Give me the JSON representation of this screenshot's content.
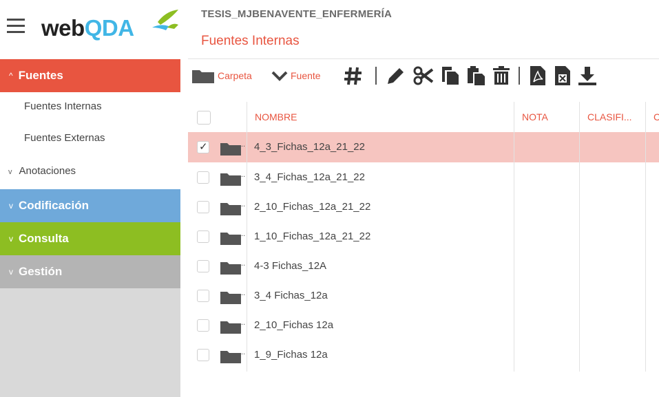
{
  "app": {
    "logo_web": "web",
    "logo_qda": "QDA"
  },
  "sidebar": {
    "fuentes": "Fuentes",
    "fuentes_internas": "Fuentes Internas",
    "fuentes_externas": "Fuentes Externas",
    "anotaciones": "Anotaciones",
    "codificacion": "Codificación",
    "consulta": "Consulta",
    "gestion": "Gestión",
    "colors": {
      "fuentes": "#e85540",
      "codificacion": "#6fa9da",
      "consulta": "#8dbe22",
      "gestion": "#b4b4b4"
    }
  },
  "header": {
    "project": "TESIS_MJBENAVENTE_ENFERMERÍA",
    "page": "Fuentes Internas"
  },
  "toolbar": {
    "carpeta": "Carpeta",
    "fuente": "Fuente"
  },
  "table": {
    "columns": [
      "NOMBRE",
      "NOTA",
      "CLASIFI...",
      "C"
    ],
    "rows": [
      {
        "name": "4_3_Fichas_12a_21_22",
        "selected": true
      },
      {
        "name": "3_4_Fichas_12a_21_22",
        "selected": false
      },
      {
        "name": "2_10_Fichas_12a_21_22",
        "selected": false
      },
      {
        "name": "1_10_Fichas_12a_21_22",
        "selected": false
      },
      {
        "name": "4-3 Fichas_12A",
        "selected": false
      },
      {
        "name": "3_4 Fichas_12a",
        "selected": false
      },
      {
        "name": "2_10_Fichas 12a",
        "selected": false
      },
      {
        "name": "1_9_Fichas 12a",
        "selected": false
      }
    ],
    "row_dots": ".."
  }
}
